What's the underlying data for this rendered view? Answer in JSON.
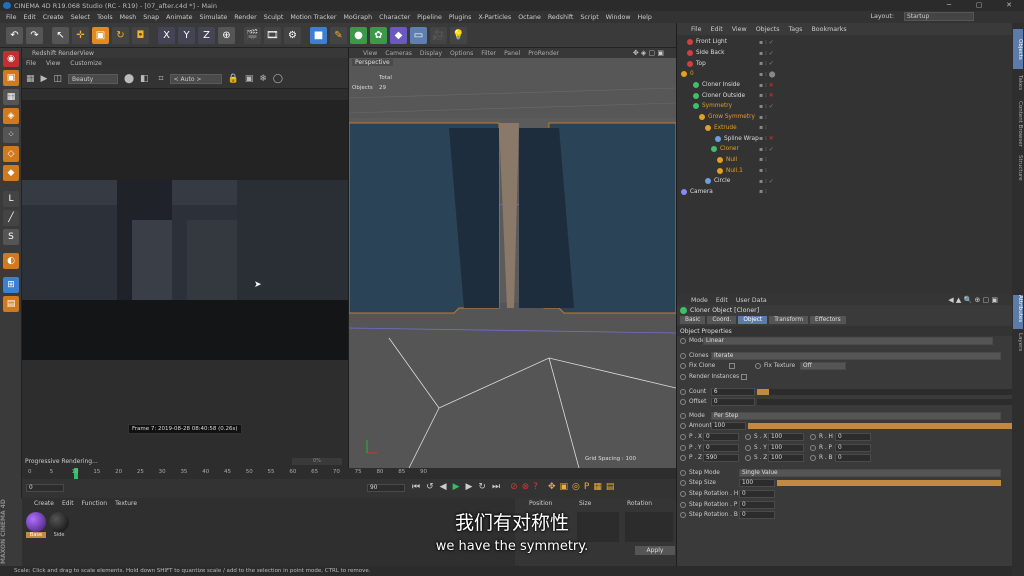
{
  "window": {
    "title": "CINEMA 4D R19.068 Studio (RC - R19) - [07_after.c4d *] - Main",
    "min": "─",
    "max": "▢",
    "close": "✕"
  },
  "menu": [
    "File",
    "Edit",
    "Create",
    "Select",
    "Tools",
    "Mesh",
    "Snap",
    "Animate",
    "Simulate",
    "Render",
    "Sculpt",
    "Motion Tracker",
    "MoGraph",
    "Character",
    "Pipeline",
    "Plugins",
    "X-Particles",
    "Octane",
    "Redshift",
    "Script",
    "Window",
    "Help"
  ],
  "layout": {
    "label": "Layout:",
    "value": "Startup"
  },
  "renderview": {
    "title": "Redshift RenderView",
    "menu": [
      "File",
      "View",
      "Customize"
    ],
    "aov": "Beauty",
    "auto": "< Auto >",
    "frame_info": "Frame 7: 2019-08-28 08:40:58 (0.26s)",
    "progress_label": "Progressive Rendering...",
    "progress_pct": "0%"
  },
  "viewport": {
    "menu": [
      "View",
      "Cameras",
      "Display",
      "Options",
      "Filter",
      "Panel",
      "ProRender"
    ],
    "camera": "Perspective",
    "stats_header": "Total",
    "stats_label": "Objects",
    "stats_value": "29",
    "grid_spacing": "Grid Spacing : 100"
  },
  "objects": {
    "menu": [
      "File",
      "Edit",
      "View",
      "Objects",
      "Tags",
      "Bookmarks"
    ],
    "items": [
      {
        "name": "Front Light",
        "indent": 0,
        "color": "#d04040"
      },
      {
        "name": "Side Back",
        "indent": 0,
        "color": "#d04040"
      },
      {
        "name": "Top",
        "indent": 0,
        "color": "#d04040"
      },
      {
        "name": "0",
        "indent": 0,
        "color": "#e0a020"
      },
      {
        "name": "Cloner Inside",
        "indent": 1,
        "color": "#3fbf6a"
      },
      {
        "name": "Cloner Outside",
        "indent": 1,
        "color": "#3fbf6a"
      },
      {
        "name": "Symmetry",
        "indent": 1,
        "color": "#3fbf6a"
      },
      {
        "name": "Grow Symmetry",
        "indent": 2,
        "color": "#e0a020"
      },
      {
        "name": "Extrude",
        "indent": 3,
        "color": "#e0a020"
      },
      {
        "name": "Spline Wrap",
        "indent": 4,
        "color": "#6aa0e0"
      },
      {
        "name": "Cloner",
        "indent": 4,
        "color": "#3fbf6a"
      },
      {
        "name": "Null",
        "indent": 5,
        "color": "#e0a020"
      },
      {
        "name": "Null.1",
        "indent": 5,
        "color": "#e0a020"
      },
      {
        "name": "Circle",
        "indent": 3,
        "color": "#6aa0e0"
      },
      {
        "name": "Camera",
        "indent": 0,
        "color": "#8888ff"
      }
    ]
  },
  "side_tabs": [
    "Objects",
    "Takes",
    "Content Browser",
    "Structure"
  ],
  "side_tabs_lower": [
    "Attributes",
    "Layers"
  ],
  "attributes": {
    "menu": [
      "Mode",
      "Edit",
      "User Data"
    ],
    "title": "Cloner Object [Cloner]",
    "tabs": [
      "Basic",
      "Coord.",
      "Object",
      "Transform",
      "Effectors"
    ],
    "section": "Object Properties",
    "mode_label": "Mode",
    "mode_value": "Linear",
    "clones_label": "Clones",
    "clones_value": "Iterate",
    "fix_clone": "Fix Clone",
    "fix_texture": "Fix Texture",
    "fix_texture_value": "Off",
    "render_instances": "Render Instances",
    "count_label": "Count",
    "count_value": "6",
    "offset_label": "Offset",
    "offset_value": "0",
    "mode2_label": "Mode",
    "mode2_value": "Per Step",
    "amount_label": "Amount",
    "amount_value": "100",
    "px": "P . X",
    "py": "P . Y",
    "pz": "P . Z",
    "px_v": "0",
    "py_v": "0",
    "pz_v": "590",
    "sx": "S . X",
    "sy": "S . Y",
    "sz": "S . Z",
    "sx_v": "100",
    "sy_v": "100",
    "sz_v": "100",
    "rh": "R . H",
    "rp": "R . P",
    "rb": "R . B",
    "rh_v": "0",
    "rp_v": "0",
    "rb_v": "0",
    "step_mode_label": "Step Mode",
    "step_mode_value": "Single Value",
    "step_size_label": "Step Size",
    "step_size_value": "100",
    "srh": "Step Rotation . H",
    "srp": "Step Rotation . P",
    "srb": "Step Rotation . B",
    "srh_v": "0",
    "srp_v": "0",
    "srb_v": "0"
  },
  "timeline": {
    "ticks": [
      "0",
      "5",
      "10",
      "15",
      "20",
      "25",
      "30",
      "35",
      "40",
      "45",
      "50",
      "55",
      "60",
      "65",
      "70",
      "75",
      "80",
      "85",
      "90"
    ],
    "current": "7",
    "start": "0",
    "end": "90"
  },
  "materials": {
    "menu": [
      "Create",
      "Edit",
      "Function",
      "Texture"
    ],
    "items": [
      "Base",
      "Side"
    ]
  },
  "coords": {
    "headers": [
      "Position",
      "Size",
      "Rotation"
    ],
    "apply": "Apply"
  },
  "status": "Scale: Click and drag to scale elements. Hold down SHIFT to quantize scale / add to the selection in point mode, CTRL to remove.",
  "subtitle": {
    "zh": "我们有对称性",
    "en": "we have the symmetry."
  },
  "brand": "MAXON CINEMA 4D"
}
